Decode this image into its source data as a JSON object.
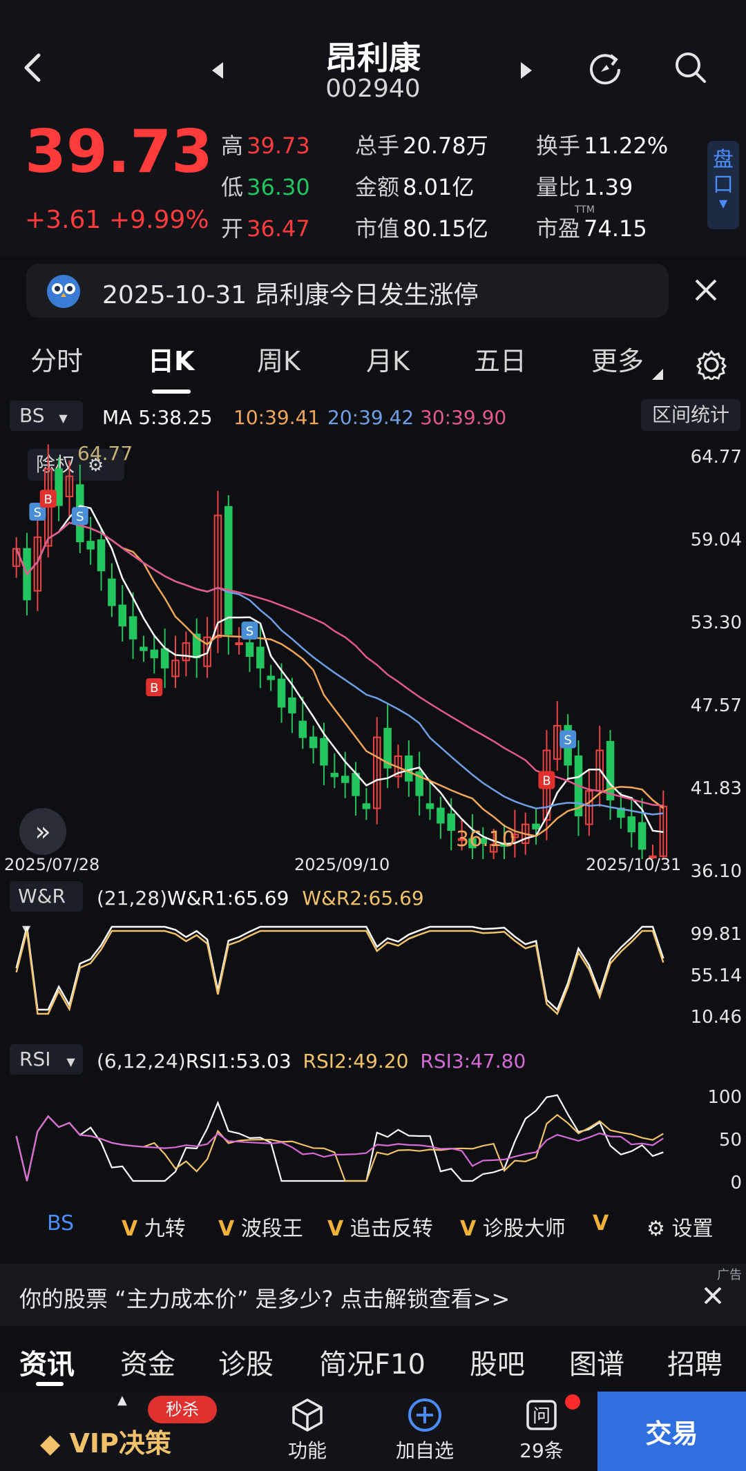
{
  "header": {
    "title": "昂利康",
    "code": "002940"
  },
  "quote": {
    "price": "39.73",
    "change": "+3.61",
    "change_pct": "+9.99%",
    "high_label": "高",
    "high": "39.73",
    "low_label": "低",
    "low": "36.30",
    "open_label": "开",
    "open": "36.47",
    "vol_label": "总手",
    "vol": "20.78万",
    "amount_label": "金额",
    "amount": "8.01亿",
    "mcap_label": "市值",
    "mcap": "80.15亿",
    "turnover_label": "换手",
    "turnover": "11.22%",
    "vratio_label": "量比",
    "vratio": "1.39",
    "pe_label": "市盈",
    "pe_sup": "TTM",
    "pe": "74.15",
    "side_label_1": "盘",
    "side_label_2": "口"
  },
  "notice": {
    "text": "2025-10-31 昂利康今日发生涨停"
  },
  "tabs": [
    {
      "label": "分时"
    },
    {
      "label": "日K"
    },
    {
      "label": "周K"
    },
    {
      "label": "月K"
    },
    {
      "label": "五日"
    },
    {
      "label": "更多"
    }
  ],
  "ma": {
    "bs_label": "BS",
    "ma5": "MA 5:38.25",
    "ma10": "10:39.41",
    "ma20": "20:39.42",
    "ma30": "30:39.90",
    "range_btn": "区间统计",
    "exright": "除权",
    "high_mark": "64.77",
    "low_mark": "36.10",
    "yticks": [
      "64.77",
      "59.04",
      "53.30",
      "47.57",
      "41.83",
      "36.10"
    ],
    "dates": [
      "2025/07/28",
      "2025/09/10",
      "2025/10/31"
    ],
    "colors": {
      "ma5": "#ffffff",
      "ma10": "#f2a65a",
      "ma20": "#6fa0e6",
      "ma30": "#e35a8a",
      "up": "#ef4444",
      "down": "#22c55e"
    }
  },
  "wr": {
    "label": "W&R",
    "params": "(21,28)",
    "wr1": "W&R1:65.69",
    "wr2": "W&R2:65.69",
    "yticks": [
      "99.81",
      "55.14",
      "10.46"
    ]
  },
  "rsi": {
    "label": "RSI",
    "params": "(6,12,24)",
    "rsi1": "RSI1:53.03",
    "rsi2": "RSI2:49.20",
    "rsi3": "RSI3:47.80",
    "yticks": [
      "100",
      "50",
      "0"
    ]
  },
  "features": {
    "bs": "BS",
    "items": [
      "九转",
      "波段王",
      "追击反转",
      "诊股大师"
    ],
    "settings": "设置"
  },
  "ad": {
    "tag": "广告",
    "text": "你的股票 “主力成本价” 是多少? 点击解锁查看>>"
  },
  "subtabs": [
    "资讯",
    "资金",
    "诊股",
    "简况F10",
    "股吧",
    "图谱",
    "招聘"
  ],
  "bottombar": {
    "vip": "VIP决策",
    "flash": "秒杀",
    "func": "功能",
    "add": "加自选",
    "ask": "29条",
    "trade": "交易"
  },
  "chart_data": {
    "type": "candlestick",
    "ylim": [
      36.1,
      64.77
    ],
    "closes": [
      57.5,
      54,
      58.3,
      63,
      60.5,
      62.5,
      58,
      57.5,
      56,
      53.6,
      52.2,
      51.3,
      50.5,
      50,
      49.3,
      49.8,
      51,
      50,
      51.4,
      59.8,
      51.6,
      51,
      50.1,
      49.3,
      48.5,
      46.6,
      46.2,
      44.5,
      43.8,
      42.6,
      41.8,
      41.4,
      40.5,
      39.6,
      44.5,
      42.4,
      43.2,
      41.5,
      40.5,
      39.6,
      38.6,
      38.1,
      37.5,
      36.9,
      37.2,
      37.1,
      37.0,
      37.8,
      38.5,
      38.2,
      43.6,
      45.3,
      42.6,
      39.1,
      40.8,
      43.6,
      40.2,
      39.0,
      38.0,
      36.8,
      36.3,
      39.73
    ]
  }
}
